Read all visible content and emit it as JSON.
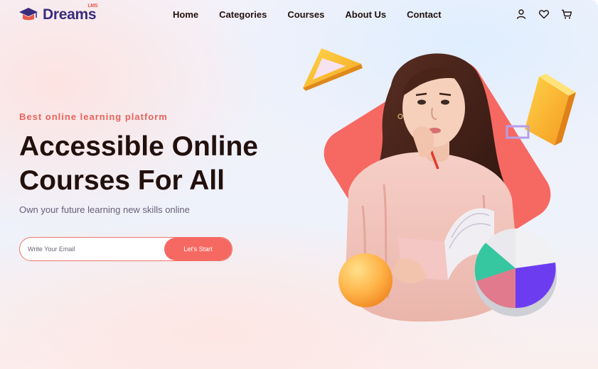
{
  "brand": {
    "name": "Dreams",
    "suffix": "LMS"
  },
  "nav": {
    "items": [
      {
        "label": "Home"
      },
      {
        "label": "Categories"
      },
      {
        "label": "Courses"
      },
      {
        "label": "About Us"
      },
      {
        "label": "Contact"
      }
    ]
  },
  "header_icons": [
    "user-icon",
    "heart-icon",
    "cart-icon"
  ],
  "hero": {
    "eyebrow": "Best online learning platform",
    "title": "Accessible Online\nCourses For All",
    "subtitle": "Own your future learning new skills online",
    "email_placeholder": "Write Your Email",
    "cta_label": "Let's Start"
  },
  "colors": {
    "brand": "#392c7d",
    "accent": "#f66962",
    "heading": "#22100d",
    "muted": "#685f78"
  }
}
